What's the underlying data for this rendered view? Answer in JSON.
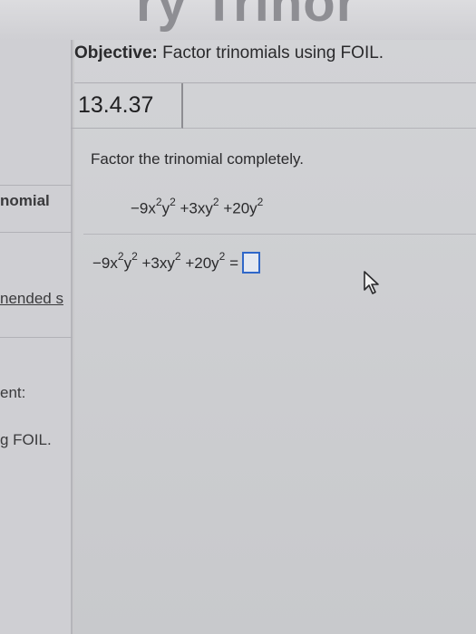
{
  "header": {
    "title_fragment": "ry Trinor"
  },
  "sidebar": {
    "fragments": [
      {
        "text": "nomial"
      },
      {
        "text": "nended s"
      },
      {
        "text": "ent:"
      },
      {
        "text": "g FOIL."
      }
    ]
  },
  "objective": {
    "label": "Objective:",
    "text": " Factor trinomials using FOIL."
  },
  "problem": {
    "id": "13.4.37",
    "instruction": "Factor the trinomial completely.",
    "expression": {
      "t1_coef": "−9x",
      "t1_exp": "2",
      "t1_var": "y",
      "t1_var_exp": "2",
      "t2": "+3xy",
      "t2_exp": "2",
      "t3": "+20y",
      "t3_exp": "2"
    },
    "answer": {
      "equals": "=",
      "value": ""
    }
  },
  "colors": {
    "answer_box_border": "#2f67c9"
  },
  "icons": {
    "cursor": "mouse-pointer-icon"
  }
}
